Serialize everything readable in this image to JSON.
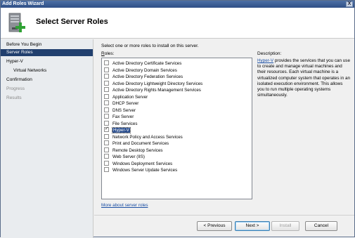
{
  "window": {
    "title": "Add Roles Wizard",
    "close_label": "X"
  },
  "header": {
    "title": "Select Server Roles"
  },
  "nav": {
    "items": [
      {
        "label": "Before You Begin",
        "state": "normal"
      },
      {
        "label": "Server Roles",
        "state": "selected"
      },
      {
        "label": "Hyper-V",
        "state": "normal"
      },
      {
        "label": "Virtual Networks",
        "state": "sub"
      },
      {
        "label": "Confirmation",
        "state": "normal"
      },
      {
        "label": "Progress",
        "state": "disabled"
      },
      {
        "label": "Results",
        "state": "disabled"
      }
    ]
  },
  "main": {
    "instruction": "Select one or more roles to install on this server.",
    "roles_label_prefix": "R",
    "roles_label_rest": "oles:",
    "roles": [
      {
        "label": "Active Directory Certificate Services",
        "checked": false
      },
      {
        "label": "Active Directory Domain Services",
        "checked": false
      },
      {
        "label": "Active Directory Federation Services",
        "checked": false
      },
      {
        "label": "Active Directory Lightweight Directory Services",
        "checked": false
      },
      {
        "label": "Active Directory Rights Management Services",
        "checked": false
      },
      {
        "label": "Application Server",
        "checked": false
      },
      {
        "label": "DHCP Server",
        "checked": false
      },
      {
        "label": "DNS Server",
        "checked": false
      },
      {
        "label": "Fax Server",
        "checked": false
      },
      {
        "label": "File Services",
        "checked": false
      },
      {
        "label": "Hyper-V",
        "checked": true,
        "highlighted": true
      },
      {
        "label": "Network Policy and Access Services",
        "checked": false
      },
      {
        "label": "Print and Document Services",
        "checked": false
      },
      {
        "label": "Remote Desktop Services",
        "checked": false
      },
      {
        "label": "Web Server (IIS)",
        "checked": false
      },
      {
        "label": "Windows Deployment Services",
        "checked": false
      },
      {
        "label": "Windows Server Update Services",
        "checked": false
      }
    ],
    "description_title": "Description:",
    "description_link": "Hyper-V",
    "description_text": " provides the services that you can use to create and manage virtual machines and their resources. Each virtual machine is a virtualized computer system that operates in an isolated execution environment. This allows you to run multiple operating systems simultaneously.",
    "more_link": "More about server roles"
  },
  "footer": {
    "previous": "< Previous",
    "next": "Next >",
    "install": "Install",
    "cancel": "Cancel"
  },
  "colors": {
    "selected_nav": "#213f6e",
    "link": "#1a4ea3",
    "titlebar": "#2f4f86"
  },
  "icons": {
    "header": "server-roles-add-icon",
    "close": "close-icon"
  }
}
